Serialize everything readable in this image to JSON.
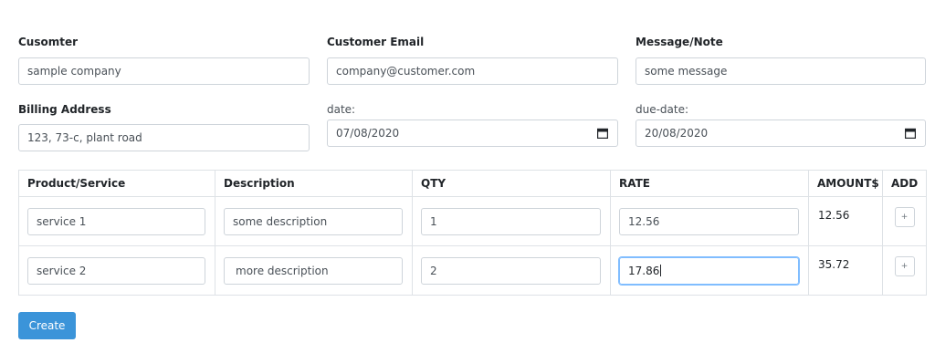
{
  "form": {
    "customer": {
      "label": "Cusomter",
      "value": "sample company"
    },
    "email": {
      "label": "Customer Email",
      "value": "company@customer.com"
    },
    "note": {
      "label": "Message/Note",
      "value": "some message"
    },
    "billing": {
      "label": "Billing Address",
      "value": "123, 73-c, plant road"
    },
    "date": {
      "label": "date:",
      "value": "07/08/2020",
      "icon": "calendar-icon"
    },
    "due_date": {
      "label": "due-date:",
      "value": "20/08/2020",
      "icon": "calendar-icon"
    }
  },
  "table": {
    "headers": [
      "Product/Service",
      "Description",
      "QTY",
      "RATE",
      "AMOUNT$",
      "ADD"
    ],
    "rows": [
      {
        "product": "service 1",
        "description": "some description",
        "qty": "1",
        "rate": "12.56",
        "amount": "12.56",
        "add": "+"
      },
      {
        "product": "service 2",
        "description": "more description",
        "qty": "2",
        "rate": "17.86",
        "amount": "35.72",
        "add": "+"
      }
    ]
  },
  "actions": {
    "create_label": "Create"
  },
  "colors": {
    "primary": "#3b94d9",
    "focus_border": "#80bdff",
    "border": "#ced4da"
  }
}
